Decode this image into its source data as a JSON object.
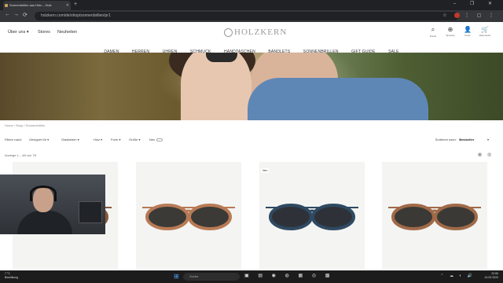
{
  "browser": {
    "tab_title": "Sonnenbrillen aus Holz – Holz",
    "new_tab": "+",
    "window_controls": "–  ❐  ✕",
    "url": "holzkern.com/de/shop/sonnenbrillen/pr1",
    "back": "←",
    "forward": "→",
    "reload": "⟳"
  },
  "header": {
    "left_links": [
      "Über uns",
      "Stores",
      "Neuheiten"
    ],
    "logo": "HOLZKERN",
    "icons": [
      {
        "icon": "search-icon",
        "glyph": "⌕",
        "label": "Suche"
      },
      {
        "icon": "globe-icon",
        "glyph": "⊕",
        "label": "Sprache"
      },
      {
        "icon": "user-icon",
        "glyph": "👤",
        "label": "Konto"
      },
      {
        "icon": "cart-icon",
        "glyph": "🛒",
        "label": "Warenkorb"
      }
    ]
  },
  "main_nav": [
    "DAMEN",
    "HERREN",
    "UHREN",
    "SCHMUCK",
    "HANDTASCHEN",
    "BANDLETS",
    "SONNENBRILLEN",
    "GIFT GUIDE",
    "SALE"
  ],
  "breadcrumb": "Home / Shop / Sonnenbrillen",
  "filters": {
    "label": "Filtern nach:",
    "items": [
      "Geeignet für",
      "Glasfarben",
      "Holz",
      "Form",
      "Größe",
      "Neu"
    ],
    "sort_label": "Sortieren nach:",
    "sort_value": "Bestseller"
  },
  "result_count": "Anzeige 1 – 48 von 78",
  "products": [
    {
      "badge": "",
      "frame_color": "#8a5a3a",
      "lens_color": "#3d3b38"
    },
    {
      "badge": "",
      "frame_color": "#b87a55",
      "lens_color": "#3b3a37"
    },
    {
      "badge": "Neu",
      "frame_color": "#2f4a63",
      "lens_color": "#2e3238"
    },
    {
      "badge": "",
      "frame_color": "#a06a48",
      "lens_color": "#3b3936"
    }
  ],
  "taskbar": {
    "weather_temp": "7 °C",
    "weather_text": "Bewölkung",
    "search_placeholder": "Suche",
    "time": "22:50",
    "date": "14.02.2024"
  }
}
